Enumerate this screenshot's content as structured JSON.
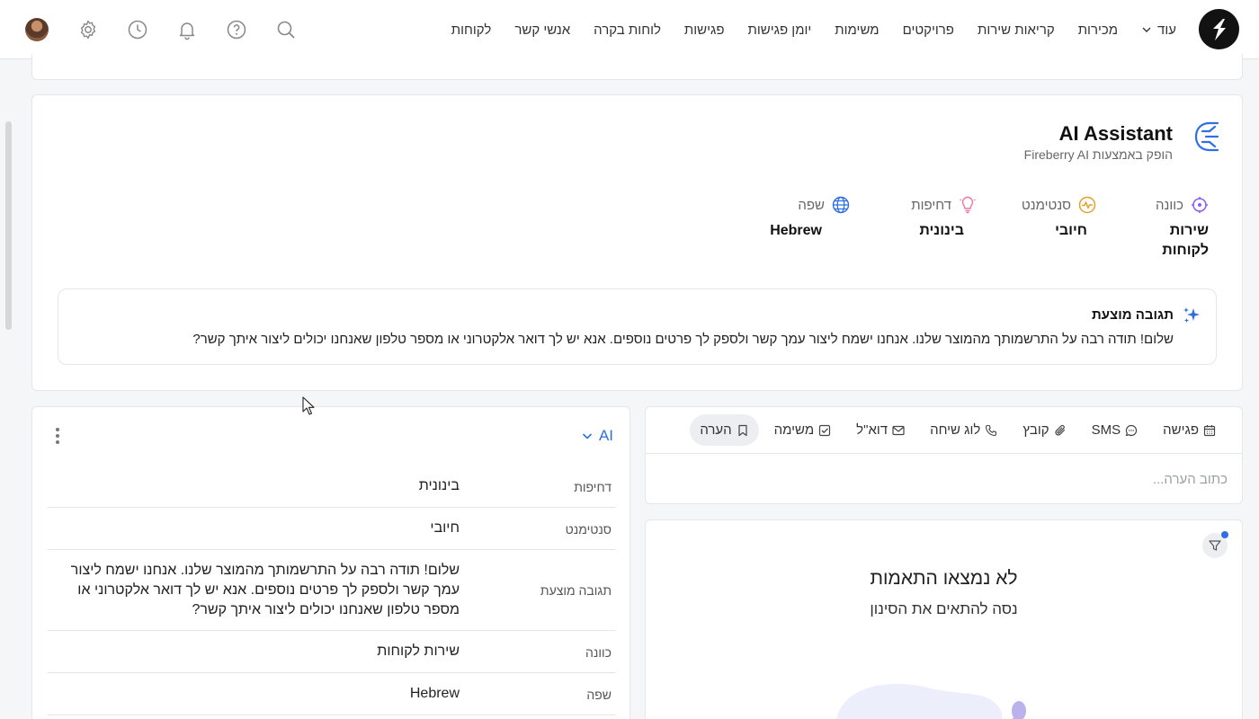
{
  "nav": {
    "items": [
      "לקוחות",
      "אנשי קשר",
      "לוחות בקרה",
      "פגישות",
      "יומן פגישות",
      "משימות",
      "פרויקטים",
      "קריאות שירות",
      "מכירות"
    ],
    "more_label": "עוד"
  },
  "top_icons": [
    "search-icon",
    "help-icon",
    "bell-icon",
    "history-icon",
    "gear-icon"
  ],
  "ai_card": {
    "title": "AI Assistant",
    "subtitle": "הופק באמצעות Fireberry AI",
    "attributes": [
      {
        "icon": "target-icon",
        "label": "כוונה",
        "value": "שירות לקוחות"
      },
      {
        "icon": "pulse-icon",
        "label": "סנטימנט",
        "value": "חיובי"
      },
      {
        "icon": "lightbulb-icon",
        "label": "דחיפות",
        "value": "בינונית"
      },
      {
        "icon": "globe-icon",
        "label": "שפה",
        "value": "Hebrew"
      }
    ],
    "suggestion": {
      "title": "תגובה מוצעת",
      "text": "שלום! תודה רבה על התרשמותך מהמוצר שלנו. אנחנו ישמח ליצור עמך קשר ולספק לך פרטים נוספים. אנא יש לך דואר אלקטרוני או מספר טלפון שאנחנו יכולים ליצור איתך קשר?"
    }
  },
  "composer": {
    "tabs": [
      {
        "label": "הערה",
        "icon": "bookmark-icon",
        "active": true
      },
      {
        "label": "משימה",
        "icon": "checkbox-icon",
        "active": false
      },
      {
        "label": "דוא\"ל",
        "icon": "mail-icon",
        "active": false
      },
      {
        "label": "לוג שיחה",
        "icon": "phone-icon",
        "active": false
      },
      {
        "label": "קובץ",
        "icon": "paperclip-icon",
        "active": false
      },
      {
        "label": "SMS",
        "icon": "chat-icon",
        "active": false
      },
      {
        "label": "פגישה",
        "icon": "calendar-icon",
        "active": false
      }
    ],
    "placeholder": "כתוב הערה..."
  },
  "feed": {
    "empty_title": "לא נמצאו התאמות",
    "empty_subtitle": "נסה להתאים את הסינון"
  },
  "ai_panel": {
    "title": "AI",
    "rows": [
      {
        "label": "דחיפות",
        "value": "בינונית"
      },
      {
        "label": "סנטימנט",
        "value": "חיובי"
      },
      {
        "label": "תגובה מוצעת",
        "value": "שלום! תודה רבה על התרשמותך מהמוצר שלנו. אנחנו ישמח ליצור עמך קשר ולספק לך פרטים נוספים. אנא יש לך דואר אלקטרוני או מספר טלפון שאנחנו יכולים ליצור איתך קשר?"
      },
      {
        "label": "כוונה",
        "value": "שירות לקוחות"
      },
      {
        "label": "שפה",
        "value": "Hebrew"
      }
    ]
  },
  "colors": {
    "accent": "#2f6fe4",
    "target": "#8b5cf6",
    "pulse": "#e0a22a",
    "lightbulb": "#e879a8",
    "globe": "#2f6fe4"
  }
}
